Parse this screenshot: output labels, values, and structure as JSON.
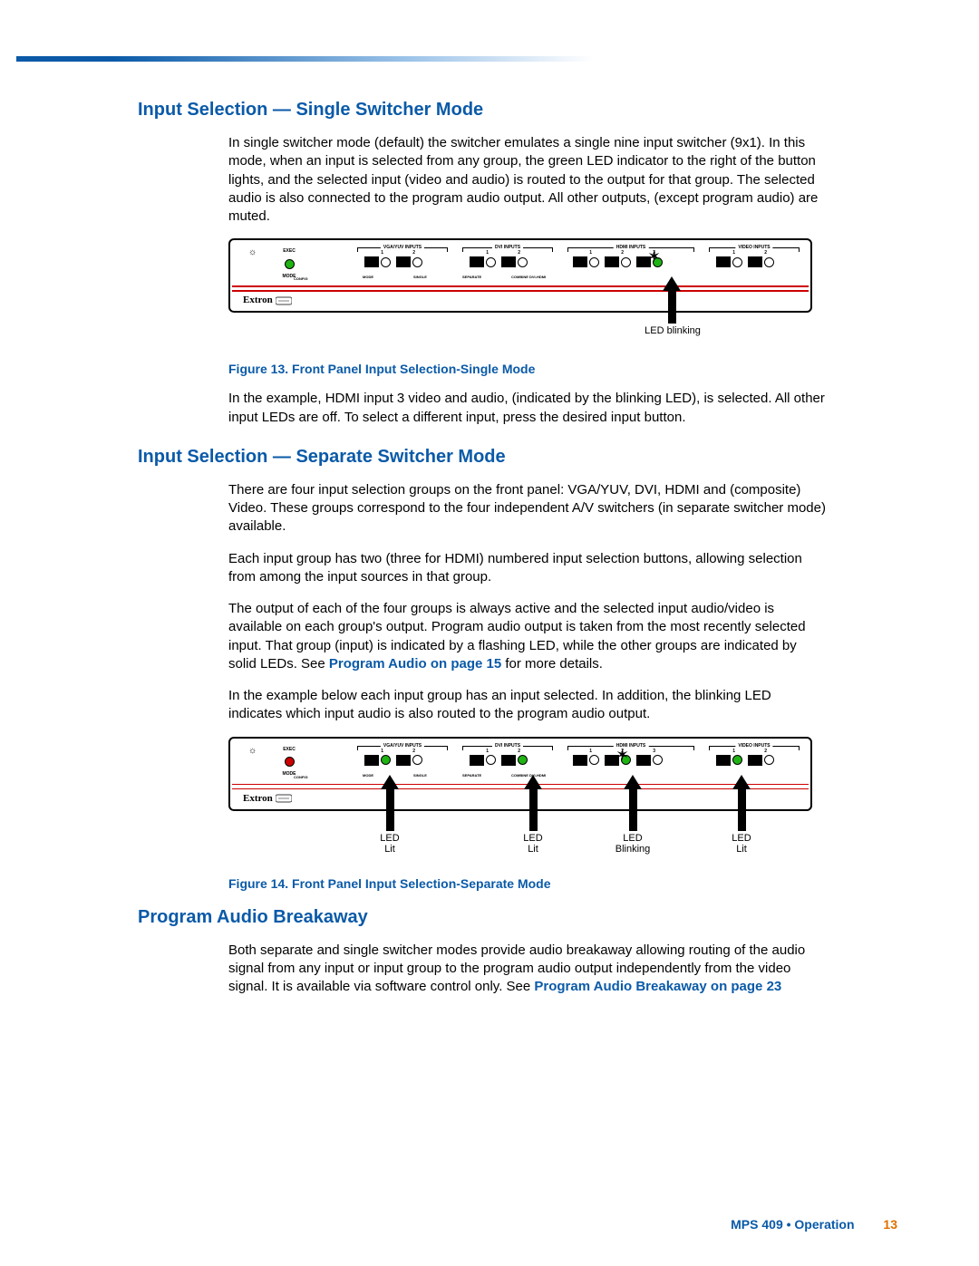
{
  "headings": {
    "h1": "Input Selection — Single Switcher Mode",
    "h2": "Input Selection — Separate Switcher Mode",
    "h3": "Program Audio Breakaway"
  },
  "paragraphs": {
    "p1": "In single switcher mode (default) the switcher emulates a single nine input switcher (9x1). In this mode, when an input is selected from any group, the green LED indicator to the right of the button lights, and the selected input (video and audio) is routed to the output for that group. The selected audio is also connected to the program audio output. All other outputs, (except program audio) are muted.",
    "p2": "In the example, HDMI input 3 video and audio, (indicated by the blinking LED), is selected. All other input LEDs are off. To select a different input, press the desired input button.",
    "p3": "There are four input selection groups on the front panel: VGA/YUV, DVI, HDMI and (composite) Video. These groups correspond to the four independent A/V switchers (in separate switcher mode) available.",
    "p4": "Each input group has two (three for HDMI) numbered input selection buttons, allowing selection from among the input sources in that group.",
    "p5a": "The output of each of the four groups is always active and the selected input audio/video is available on each group's output. Program audio output is taken from the most recently selected input. That group (input) is indicated by a flashing LED, while the other groups are indicated by solid LEDs. See ",
    "p5link": "Program Audio on page 15",
    "p5b": " for more details.",
    "p6": "In the example below each input group has an input selected. In addition, the blinking LED indicates which input audio is also routed to the program audio output.",
    "p7a": "Both separate and single switcher modes provide audio breakaway allowing routing of the audio signal from any input or input group to the program audio output independently from the video signal. It is available via software control only. See ",
    "p7link": "Program Audio Breakaway on page 23"
  },
  "captions": {
    "fig13": "Figure 13. Front Panel Input Selection-Single Mode",
    "fig14": "Figure 14. Front Panel Input Selection-Separate Mode"
  },
  "panel": {
    "brand": "Extron",
    "exec": "EXEC",
    "mode": "MODE",
    "config": "CONFIG",
    "groups": {
      "vga": "VGA/YUV INPUTS",
      "dvi": "DVI INPUTS",
      "hdmi": "HDMI INPUTS",
      "video": "VIDEO INPUTS"
    },
    "sublabels": {
      "mode": "MODE",
      "single": "SINGLE",
      "separate": "SEPARATE",
      "combine": "COMBINE DVI-HDMI"
    }
  },
  "arrows": {
    "led_blinking": "LED blinking",
    "led_lit": "LED\nLit",
    "led_lit2": "LED\nLit",
    "led_blinking2": "LED\nBlinking",
    "led_lit3": "LED\nLit"
  },
  "footer": {
    "doc": "MPS 409 • Operation",
    "page": "13"
  }
}
